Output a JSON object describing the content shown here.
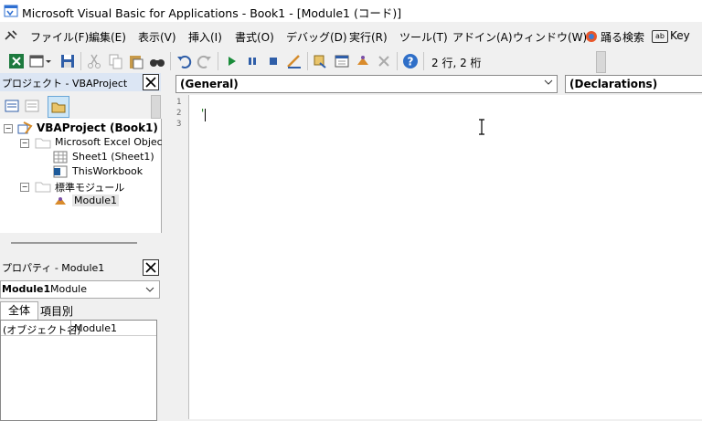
{
  "window": {
    "title": "Microsoft Visual Basic for Applications - Book1 - [Module1 (コード)]"
  },
  "menu": {
    "items": [
      {
        "label": "ファイル(F)"
      },
      {
        "label": "編集(E)"
      },
      {
        "label": "表示(V)"
      },
      {
        "label": "挿入(I)"
      },
      {
        "label": "書式(O)"
      },
      {
        "label": "デバッグ(D)"
      },
      {
        "label": "実行(R)"
      },
      {
        "label": "ツール(T)"
      },
      {
        "label": "アドイン(A)"
      },
      {
        "label": "ウィンドウ(W)"
      }
    ],
    "search_label": "踊る検索",
    "key_label": "Key",
    "key_badge": "ab"
  },
  "toolbar": {
    "position_text": "2 行, 2 桁"
  },
  "project_pane": {
    "title": "プロジェクト - VBAProject",
    "tree": {
      "root": "VBAProject (Book1)",
      "excel_objects": "Microsoft Excel Objec",
      "sheet1": "Sheet1 (Sheet1)",
      "thisworkbook": "ThisWorkbook",
      "std_modules": "標準モジュール",
      "module1": "Module1"
    }
  },
  "properties_pane": {
    "title": "プロパティ - Module1",
    "combo_name": "Module1",
    "combo_type": "Module",
    "tabs": [
      {
        "label": "全体"
      },
      {
        "label": "項目別"
      }
    ],
    "grid": {
      "prop_name": "(オブジェクト名)",
      "prop_value": "Module1"
    }
  },
  "code_window": {
    "object_combo": "(General)",
    "proc_combo": "(Declarations)",
    "line_numbers": [
      "1",
      "2",
      "3"
    ],
    "code_text": "'"
  }
}
